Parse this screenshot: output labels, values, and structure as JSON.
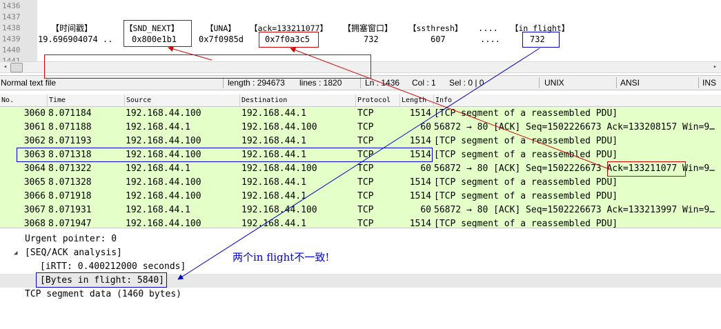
{
  "editor": {
    "line_numbers": [
      "1436",
      "1437",
      "1438",
      "1439",
      "1440",
      "1441"
    ],
    "header": {
      "timestamp": "【时间戳】",
      "snd_next": "【SND_NEXT】",
      "una": "【UNA】",
      "ack": "【ack=133211077】",
      "cwnd": "【拥塞窗口】",
      "ssthresh": "【ssthresh】",
      "ellipsis": "....",
      "in_flight": "【in flight】"
    },
    "values": {
      "timestamp": "19.696904074 ..",
      "snd_next": "0x800e1b1",
      "una": "0x7f0985d",
      "ack": "0x7f0a3c5",
      "cwnd": "732",
      "ssthresh": "607",
      "ellipsis": "....",
      "in_flight": "732"
    }
  },
  "scrollbar": {
    "left_arrow": "◂",
    "right_arrow": "▸"
  },
  "statusbar": {
    "file_type": "Normal text file",
    "length": "length : 294673",
    "lines": "lines : 1820",
    "ln": "Ln : 1436",
    "col": "Col : 1",
    "sel": "Sel : 0 | 0",
    "eol": "UNIX",
    "encoding": "ANSI",
    "mode": "INS"
  },
  "packet_list": {
    "columns": [
      "No.",
      "Time",
      "Source",
      "Destination",
      "Protocol",
      "Length",
      "Info"
    ],
    "rows": [
      {
        "no": "3060",
        "time": "8.071184",
        "src": "192.168.44.100",
        "dst": "192.168.44.1",
        "proto": "TCP",
        "len": "1514",
        "info": "[TCP segment of a reassembled PDU]"
      },
      {
        "no": "3061",
        "time": "8.071188",
        "src": "192.168.44.1",
        "dst": "192.168.44.100",
        "proto": "TCP",
        "len": "60",
        "info": "56872 → 80 [ACK] Seq=1502226673 Ack=133208157 Win=9…"
      },
      {
        "no": "3062",
        "time": "8.071193",
        "src": "192.168.44.100",
        "dst": "192.168.44.1",
        "proto": "TCP",
        "len": "1514",
        "info": "[TCP segment of a reassembled PDU]"
      },
      {
        "no": "3063",
        "time": "8.071318",
        "src": "192.168.44.100",
        "dst": "192.168.44.1",
        "proto": "TCP",
        "len": "1514",
        "info": "[TCP segment of a reassembled PDU]"
      },
      {
        "no": "3064",
        "time": "8.071322",
        "src": "192.168.44.1",
        "dst": "192.168.44.100",
        "proto": "TCP",
        "len": "60",
        "info": "56872 → 80 [ACK] Seq=1502226673 Ack=133211077 Win=9…"
      },
      {
        "no": "3065",
        "time": "8.071328",
        "src": "192.168.44.100",
        "dst": "192.168.44.1",
        "proto": "TCP",
        "len": "1514",
        "info": "[TCP segment of a reassembled PDU]"
      },
      {
        "no": "3066",
        "time": "8.071918",
        "src": "192.168.44.100",
        "dst": "192.168.44.1",
        "proto": "TCP",
        "len": "1514",
        "info": "[TCP segment of a reassembled PDU]"
      },
      {
        "no": "3067",
        "time": "8.071931",
        "src": "192.168.44.1",
        "dst": "192.168.44.100",
        "proto": "TCP",
        "len": "60",
        "info": "56872 → 80 [ACK] Seq=1502226673 Ack=133213997 Win=9…"
      },
      {
        "no": "3068",
        "time": "8.071947",
        "src": "192.168.44.100",
        "dst": "192.168.44.1",
        "proto": "TCP",
        "len": "1514",
        "info": "[TCP segment of a reassembled PDU]"
      }
    ]
  },
  "details": {
    "urgent_pointer": "Urgent pointer: 0",
    "expand_icon": "◢",
    "seq_ack": "[SEQ/ACK analysis]",
    "irtt": "[iRTT: 0.400212000 seconds]",
    "bytes_in_flight": "[Bytes in flight: 5840]",
    "segment_data": "TCP segment data (1460 bytes)"
  },
  "annotation": {
    "note": "两个in flight不一致!",
    "red": "#d40000",
    "blue": "#0000c8"
  },
  "colors": {
    "row_bg": "#e4ffc7",
    "gutter_bg": "#e4e4e4",
    "statusbar_bg": "#f0f0f0"
  }
}
